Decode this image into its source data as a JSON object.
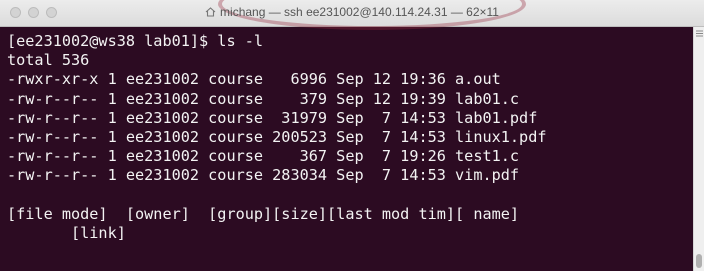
{
  "window": {
    "title": "michang — ssh ee231002@140.114.24.31 — 62×11"
  },
  "terminal": {
    "lines": [
      "[ee231002@ws38 lab01]$ ls -l",
      "total 536",
      "-rwxr-xr-x 1 ee231002 course   6996 Sep 12 19:36 a.out",
      "-rw-r--r-- 1 ee231002 course    379 Sep 12 19:39 lab01.c",
      "-rw-r--r-- 1 ee231002 course  31979 Sep  7 14:53 lab01.pdf",
      "-rw-r--r-- 1 ee231002 course 200523 Sep  7 14:53 linux1.pdf",
      "-rw-r--r-- 1 ee231002 course    367 Sep  7 19:26 test1.c",
      "-rw-r--r-- 1 ee231002 course 283034 Sep  7 14:53 vim.pdf",
      "",
      "[file mode]  [owner]  [group][size][last mod tim][ name]",
      "       [link]"
    ]
  },
  "colors": {
    "terminal_background": "#2c0b22",
    "terminal_text": "#f3f3f3",
    "titlebar": "#e4e4e4"
  }
}
